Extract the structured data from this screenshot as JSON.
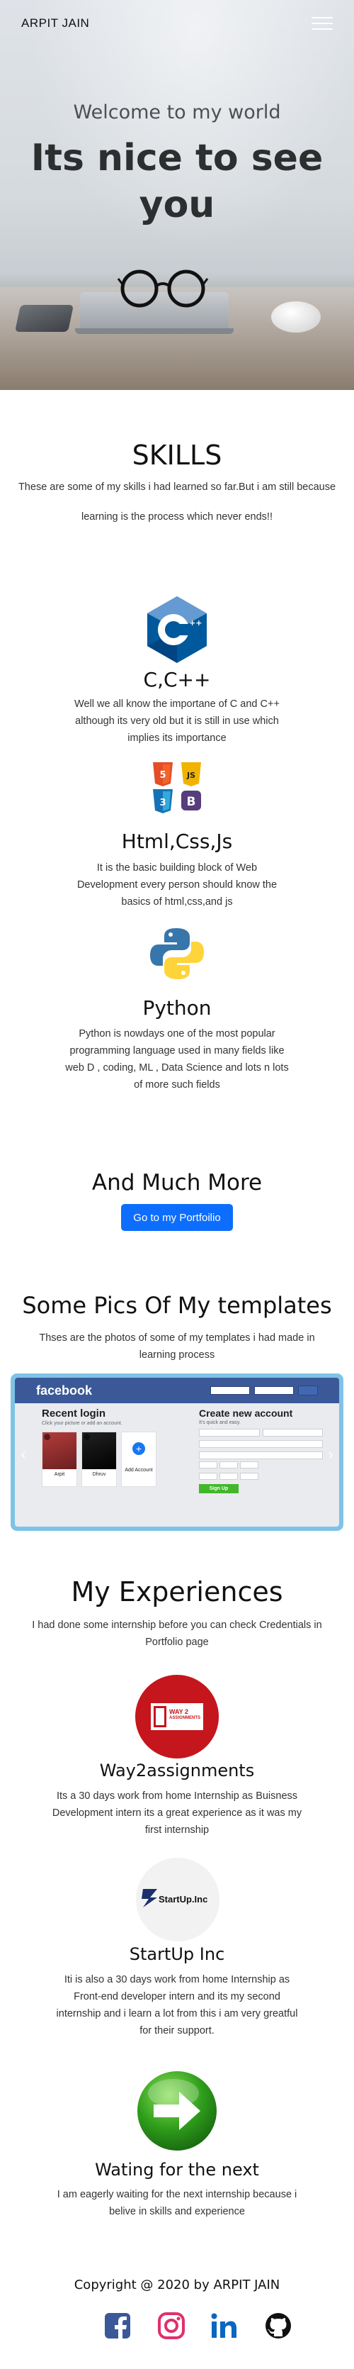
{
  "navbar": {
    "brand": "ARPIT JAIN"
  },
  "hero": {
    "subtitle": "Welcome to my world",
    "title": "Its nice to see you"
  },
  "skills": {
    "title": "SKILLS",
    "intro_line1": "These are some of my skills i had learned so far.But i am still because",
    "intro_line2": "learning is the process which never ends!!",
    "items": [
      {
        "title": "C,C++",
        "lines": [
          "Well we all know the importane of C and C++",
          "although its very old but it is still in use which",
          "implies its importance"
        ]
      },
      {
        "title": "Html,Css,Js",
        "lines": [
          "It is the basic building block of Web",
          "Development every person should know the",
          "basics of html,css,and js"
        ]
      },
      {
        "title": "Python",
        "lines": [
          "Python is nowdays one of the most popular",
          "programming language used in many fields like",
          "web D , coding, ML , Data Science and lots n lots",
          "of more such fields"
        ]
      }
    ]
  },
  "more": {
    "title": "And Much More",
    "button": "Go to my Portfoilio"
  },
  "pics": {
    "title": "Some Pics Of My templates",
    "lines": [
      "Thses are the photos of some of my templates i had made in",
      "learning process"
    ],
    "slide": {
      "logo": "facebook",
      "recent_login": "Recent login",
      "recent_sub": "Click your picture or add an account.",
      "profiles": [
        "Arpit",
        "Dhruv"
      ],
      "add_account": "Add Account",
      "create_title": "Create new account",
      "create_sub": "It's quick and easy.",
      "signup": "Sign Up"
    }
  },
  "experiences": {
    "title": "My Experiences",
    "intro_line1": "I had done some internship before you can check Credentials in",
    "intro_line2": "Portfolio page",
    "items": [
      {
        "title": "Way2assignments",
        "logo_text_1": "WAY 2",
        "logo_text_2": "ASSIGNMENTS",
        "lines": [
          "Its a 30 days work from home Internship as Buisness",
          "Development intern its a great experience as it was my",
          "first internship"
        ]
      },
      {
        "title": "StartUp Inc",
        "logo_text_1": "StartUp.Inc",
        "lines": [
          "Iti is also a 30 days work from home Internship as",
          "Front-end developer intern and its my second",
          "internship and i learn a lot from this i am very greatful",
          "for their support."
        ]
      },
      {
        "title": "Wating for the next",
        "lines": [
          "I am eagerly waiting for the next internship because i",
          "belive in skills and experience"
        ]
      }
    ]
  },
  "footer": {
    "copyright": "Copyright @ 2020 by ARPIT JAIN"
  },
  "colors": {
    "primary_button": "#0d6efd",
    "facebook": "#3b5998",
    "instagram": "#e1306c",
    "linkedin": "#0a66c2",
    "github": "#111111"
  },
  "icons": [
    "menu-icon",
    "cpp-logo-icon",
    "html5-icon",
    "css3-icon",
    "js-icon",
    "bootstrap-icon",
    "python-logo-icon",
    "facebook-icon",
    "instagram-icon",
    "linkedin-icon",
    "github-icon"
  ]
}
